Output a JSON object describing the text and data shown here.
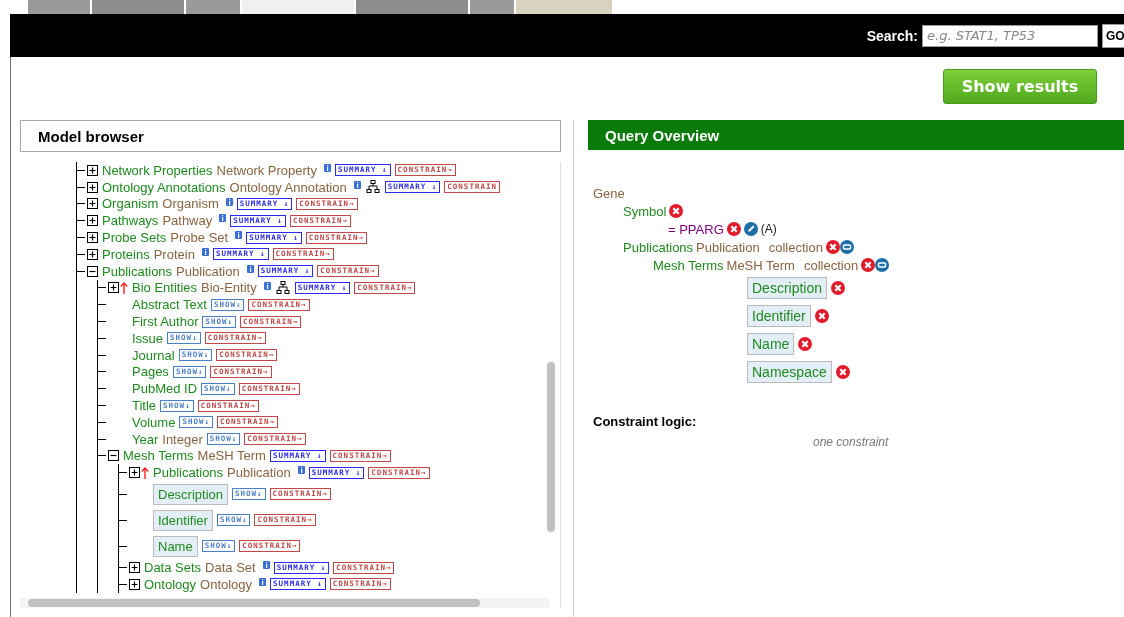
{
  "header": {
    "search_label": "Search:",
    "search_placeholder": "e.g. STAT1, TP53",
    "go": "GO"
  },
  "show_results": "Show results",
  "model_browser": {
    "title": "Model browser",
    "tree": [
      {
        "kind": "reference",
        "name": "Network Properties",
        "type": "Network Property",
        "expanded": false,
        "reverse": false,
        "info": true,
        "tree_icon": false,
        "action": "SUMMARY ↓",
        "constrain": "CONSTRAIN→"
      },
      {
        "kind": "reference",
        "name": "Ontology Annotations",
        "type": "Ontology Annotation",
        "expanded": false,
        "reverse": false,
        "info": true,
        "tree_icon": true,
        "action": "SUMMARY ↓",
        "constrain": "CONSTRAIN"
      },
      {
        "kind": "reference",
        "name": "Organism",
        "type": "Organism",
        "expanded": false,
        "reverse": false,
        "info": true,
        "tree_icon": false,
        "action": "SUMMARY ↓",
        "constrain": "CONSTRAIN→"
      },
      {
        "kind": "reference",
        "name": "Pathways",
        "type": "Pathway",
        "expanded": false,
        "reverse": false,
        "info": true,
        "tree_icon": false,
        "action": "SUMMARY ↓",
        "constrain": "CONSTRAIN→"
      },
      {
        "kind": "reference",
        "name": "Probe Sets",
        "type": "Probe Set",
        "expanded": false,
        "reverse": false,
        "info": true,
        "tree_icon": false,
        "action": "SUMMARY ↓",
        "constrain": "CONSTRAIN→"
      },
      {
        "kind": "reference",
        "name": "Proteins",
        "type": "Protein",
        "expanded": false,
        "reverse": false,
        "info": true,
        "tree_icon": false,
        "action": "SUMMARY ↓",
        "constrain": "CONSTRAIN→"
      },
      {
        "kind": "reference",
        "name": "Publications",
        "type": "Publication",
        "expanded": true,
        "reverse": false,
        "info": true,
        "tree_icon": false,
        "action": "SUMMARY ↓",
        "constrain": "CONSTRAIN→",
        "children": [
          {
            "kind": "reference",
            "name": "Bio Entities",
            "type": "Bio-Entity",
            "expanded": false,
            "reverse": true,
            "info": true,
            "tree_icon": true,
            "action": "SUMMARY ↓",
            "constrain": "CONSTRAIN→"
          },
          {
            "kind": "attribute",
            "name": "Abstract Text",
            "selected": false,
            "action": "SHOW↓",
            "constrain": "CONSTRAIN→"
          },
          {
            "kind": "attribute",
            "name": "First Author",
            "selected": false,
            "action": "SHOW↓",
            "constrain": "CONSTRAIN→"
          },
          {
            "kind": "attribute",
            "name": "Issue",
            "selected": false,
            "action": "SHOW↓",
            "constrain": "CONSTRAIN→"
          },
          {
            "kind": "attribute",
            "name": "Journal",
            "selected": false,
            "action": "SHOW↓",
            "constrain": "CONSTRAIN→"
          },
          {
            "kind": "attribute",
            "name": "Pages",
            "selected": false,
            "action": "SHOW↓",
            "constrain": "CONSTRAIN→"
          },
          {
            "kind": "attribute",
            "name": "PubMed ID",
            "selected": false,
            "action": "SHOW↓",
            "constrain": "CONSTRAIN→"
          },
          {
            "kind": "attribute",
            "name": "Title",
            "selected": false,
            "action": "SHOW↓",
            "constrain": "CONSTRAIN→"
          },
          {
            "kind": "attribute",
            "name": "Volume",
            "selected": false,
            "action": "SHOW↓",
            "constrain": "CONSTRAIN→"
          },
          {
            "kind": "attribute",
            "name": "Year",
            "type": "Integer",
            "selected": false,
            "action": "SHOW↓",
            "constrain": "CONSTRAIN→"
          },
          {
            "kind": "reference",
            "name": "Mesh Terms",
            "type": "MeSH Term",
            "expanded": true,
            "reverse": false,
            "info": false,
            "tree_icon": false,
            "action": "SUMMARY ↓",
            "constrain": "CONSTRAIN→",
            "children": [
              {
                "kind": "reference",
                "name": "Publications",
                "type": "Publication",
                "expanded": false,
                "reverse": true,
                "info": true,
                "tree_icon": false,
                "action": "SUMMARY ↓",
                "constrain": "CONSTRAIN→"
              },
              {
                "kind": "attribute",
                "name": "Description",
                "selected": true,
                "action": "SHOW↓",
                "constrain": "CONSTRAIN→"
              },
              {
                "kind": "attribute",
                "name": "Identifier",
                "selected": true,
                "action": "SHOW↓",
                "constrain": "CONSTRAIN→"
              },
              {
                "kind": "attribute",
                "name": "Name",
                "selected": true,
                "action": "SHOW↓",
                "constrain": "CONSTRAIN→"
              },
              {
                "kind": "reference",
                "name": "Data Sets",
                "type": "Data Set",
                "expanded": false,
                "reverse": false,
                "info": true,
                "tree_icon": false,
                "action": "SUMMARY ↓",
                "constrain": "CONSTRAIN→"
              },
              {
                "kind": "reference",
                "name": "Ontology",
                "type": "Ontology",
                "expanded": false,
                "reverse": false,
                "info": true,
                "tree_icon": false,
                "action": "SUMMARY ↓",
                "constrain": "CONSTRAIN→"
              }
            ]
          }
        ]
      }
    ]
  },
  "query_overview": {
    "title": "Query Overview",
    "root": "Gene",
    "items": [
      {
        "kind": "attribute",
        "name": "Symbol",
        "constraint": {
          "value": "= PPARG",
          "code": "(A)"
        }
      },
      {
        "kind": "collection",
        "name": "Publications",
        "type": "Publication",
        "note": "collection",
        "children": [
          {
            "kind": "collection",
            "name": "Mesh Terms",
            "type": "MeSH Term",
            "note": "collection",
            "children": [
              {
                "kind": "view",
                "name": "Description"
              },
              {
                "kind": "view",
                "name": "Identifier"
              },
              {
                "kind": "view",
                "name": "Name"
              },
              {
                "kind": "view",
                "name": "Namespace"
              }
            ]
          }
        ]
      }
    ],
    "constraint_logic": {
      "label": "Constraint logic:",
      "value": "one constraint"
    }
  }
}
